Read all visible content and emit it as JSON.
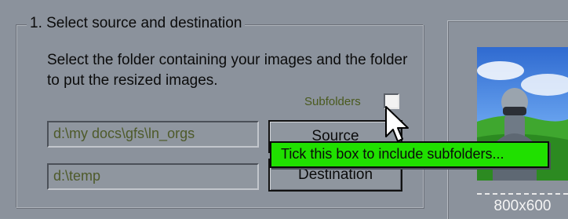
{
  "group": {
    "title": "1. Select source and destination",
    "description": "Select the folder containing your images and the folder to put the resized images."
  },
  "subfolders": {
    "label": "Subfolders",
    "checked": false
  },
  "source": {
    "path": "d:\\my docs\\gfs\\ln_orgs",
    "button_label": "Source"
  },
  "destination": {
    "path": "d:\\temp",
    "button_label": "Destination"
  },
  "tooltip": {
    "text": "Tick this box to include subfolders..."
  },
  "preview": {
    "size_label": "800x600"
  },
  "colors": {
    "background": "#8b929c",
    "tooltip": "#20e000",
    "checkbox": "#f2f2f2"
  },
  "icons": {
    "cursor": "arrow-cursor-icon"
  }
}
